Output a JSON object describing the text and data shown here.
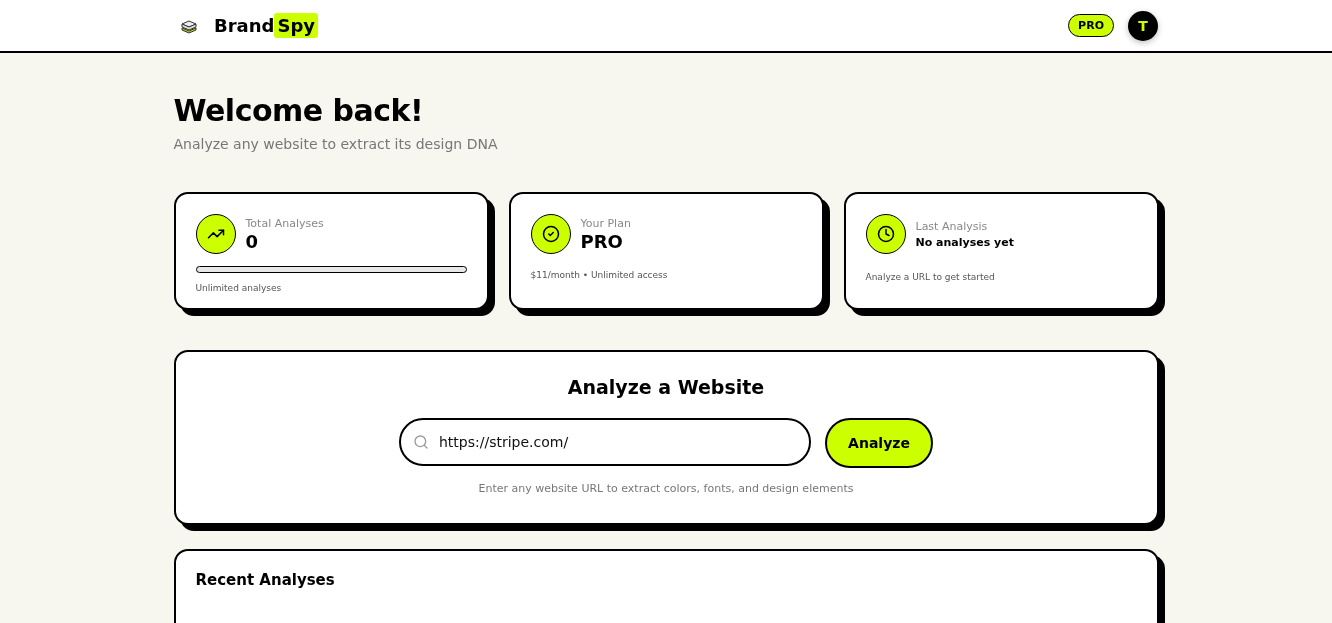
{
  "header": {
    "logo": {
      "word_1": "Brand",
      "word_2": "Spy"
    },
    "plan_badge": "PRO",
    "avatar": "T"
  },
  "welcome": {
    "title": "Welcome back!",
    "subtitle": "Analyze any website to extract its design DNA"
  },
  "stats": [
    {
      "kind": "progress",
      "label": "Total Analyses",
      "value": "0",
      "level": 0,
      "note": "Unlimited analyses"
    },
    {
      "kind": "plan",
      "label": "Your Plan",
      "value": "PRO",
      "note": "$11/month • Unlimited access"
    },
    {
      "kind": "last",
      "label": "Last Analysis",
      "value": "No analyses yet",
      "note": "Analyze a URL to get started"
    }
  ],
  "analyze": {
    "title": "Analyze a Website",
    "url_value": "https://stripe.com/",
    "button": "Analyze",
    "hint": "Enter any website URL to extract colors, fonts, and design elements"
  },
  "recent": {
    "title": "Recent Analyses"
  }
}
